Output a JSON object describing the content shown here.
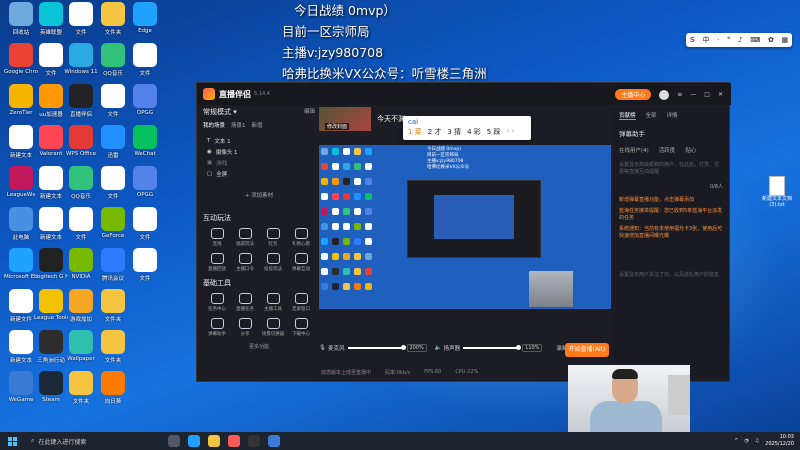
{
  "overlay": {
    "line1": "今日战绩 0mvp）",
    "line2": "目前一区宗师局",
    "line3": "主播v:jzy980708",
    "line4": "哈弗比换米VX公众号：听雪楼三角洲"
  },
  "ime_bar": {
    "items": [
      "中",
      "·",
      "°"
    ]
  },
  "desktop_icons": [
    {
      "label": "回收站",
      "color": "#6fa8dc"
    },
    {
      "label": "Google Chrome",
      "color": "#ea4335"
    },
    {
      "label": "ZeroTier",
      "color": "#f4b400"
    },
    {
      "label": "新建文本",
      "color": "#ffffff"
    },
    {
      "label": "LeagueWs",
      "color": "#c2185b"
    },
    {
      "label": "此电脑",
      "color": "#4a90e2"
    },
    {
      "label": "Microsoft Edge",
      "color": "#1fa2ff"
    },
    {
      "label": "新建文件",
      "color": "#ffffff"
    },
    {
      "label": "新建文本",
      "color": "#ffffff"
    },
    {
      "label": "WeGame",
      "color": "#3a7bd5"
    },
    {
      "label": "英雄联盟",
      "color": "#0bc3d9"
    },
    {
      "label": "文件",
      "color": "#ffffff"
    },
    {
      "label": "uu加速器",
      "color": "#ff9900"
    },
    {
      "label": "Valorant",
      "color": "#ff4655"
    },
    {
      "label": "新建文本",
      "color": "#ffffff"
    },
    {
      "label": "新建文本",
      "color": "#ffffff"
    },
    {
      "label": "Logitech G HUB",
      "color": "#222222"
    },
    {
      "label": "League Tools",
      "color": "#f2c200"
    },
    {
      "label": "三角洲行动",
      "color": "#2d2d2d"
    },
    {
      "label": "Steam",
      "color": "#1b2838"
    },
    {
      "label": "文件",
      "color": "#ffffff"
    },
    {
      "label": "Windows 11",
      "color": "#2aa8e0"
    },
    {
      "label": "直播伴侣",
      "color": "#222222"
    },
    {
      "label": "WPS Office",
      "color": "#e53935"
    },
    {
      "label": "QQ音乐",
      "color": "#31c27c"
    },
    {
      "label": "文件",
      "color": "#ffffff"
    },
    {
      "label": "NVIDIA",
      "color": "#76b900"
    },
    {
      "label": "游戏加加",
      "color": "#f5a623"
    },
    {
      "label": "Wallpaper",
      "color": "#30c0b0"
    },
    {
      "label": "文件夹",
      "color": "#f5c542"
    },
    {
      "label": "文件夹",
      "color": "#f5c542"
    },
    {
      "label": "QQ音乐",
      "color": "#31c27c"
    },
    {
      "label": "文件",
      "color": "#ffffff"
    },
    {
      "label": "迅雷",
      "color": "#1e90ff"
    },
    {
      "label": "文件",
      "color": "#ffffff"
    },
    {
      "label": "GeForce",
      "color": "#76b900"
    },
    {
      "label": "腾讯会议",
      "color": "#2f7bff"
    },
    {
      "label": "文件夹",
      "color": "#f5c542"
    },
    {
      "label": "文件夹",
      "color": "#f5c542"
    },
    {
      "label": "向日葵",
      "color": "#ff7a00"
    },
    {
      "label": "Edge",
      "color": "#1fa2ff"
    },
    {
      "label": "文件",
      "color": "#ffffff"
    },
    {
      "label": "OPGG",
      "color": "#5383e8"
    },
    {
      "label": "WeChat",
      "color": "#07c160"
    },
    {
      "label": "OPGG",
      "color": "#5383e8"
    },
    {
      "label": "文件",
      "color": "#ffffff"
    },
    {
      "label": "文件",
      "color": "#ffffff"
    }
  ],
  "app": {
    "brand": "直播伴侣",
    "version": "5.14.4",
    "top_right_badge": "主播中心",
    "left": {
      "title": "常规模式",
      "title_right": "编辑",
      "sub_tabs": [
        "我的场景",
        "场景1",
        "新增"
      ],
      "scenes": [
        "文本 1",
        "摄像头 1",
        "游戏",
        "全屏"
      ],
      "add_source": "+ 添加素材",
      "interact_h": "互动玩法",
      "tools_h": "基础工具",
      "interact_tools": [
        "连线",
        "福袋玩法",
        "红包",
        "礼物心愿",
        "直播回放",
        "主播口令",
        "投投玩法",
        "弹幕互动"
      ],
      "basic_tools": [
        "任务中心",
        "直播任务",
        "主播工具",
        "定屏窗口",
        "弹幕助手",
        "分享",
        "场景切换器",
        "下载中心"
      ],
      "more": "更多功能"
    },
    "center": {
      "cover_label": "修改封面",
      "live_title": "今天不渊",
      "buttons": [
        "保存",
        "取消"
      ],
      "stats": [
        "分享",
        "21799"
      ]
    },
    "ime_popup": {
      "code": "cai",
      "candidates": [
        "1 菜",
        "2 才",
        "3 猜",
        "4 彩",
        "5 踩"
      ]
    },
    "preview_text": [
      "今日战绩 0mvp)",
      "目前一区宗师局",
      "主播v:jzy980708",
      "哈弗比换米VX公众号"
    ],
    "controls": {
      "mic_label": "麦克风",
      "mic_pct": "200%",
      "speaker_label": "扬声器",
      "speaker_pct": "110%",
      "record": "录制",
      "settings": "设置",
      "start": "开始直播(Alt)"
    },
    "status": [
      "动态版本上线至直播中",
      "码率:0kb/s",
      "FPS:60",
      "CPU:22%"
    ],
    "right": {
      "tabs": [
        "贡献榜",
        "全部",
        "详情"
      ],
      "assistant": "弹幕助手",
      "tabs2": [
        "在线用户(4)",
        "活跃度",
        "贴心"
      ],
      "gray1": "设置显示高级昵称的用户，在此处，打赏、付费等直播互动提醒",
      "counter": "0/8人",
      "msg1": "新增弹幕直播功能，点击弹幕添加",
      "msg2": "蓝海任务接单提醒：您已收到5条蓝海平台派发的任务",
      "sys": "系统通知：当前有未使用福光卡3张，使用后可快速增加直播间曝光曝",
      "gray2": "设置显示用户关注了你，以及送礼用户的信息"
    }
  },
  "desk_file": {
    "label": "新建文本文档 (3).txt"
  },
  "taskbar": {
    "search": "在此键入进行搜索",
    "time": "10:03",
    "date": "2025/12/20"
  }
}
